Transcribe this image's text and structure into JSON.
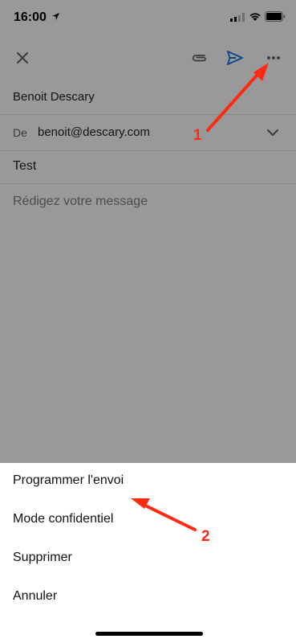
{
  "status_bar": {
    "time": "16:00"
  },
  "compose": {
    "to": "Benoit Descary",
    "from_label": "De",
    "from": "benoit@descary.com",
    "subject": "Test",
    "body_placeholder": "Rédigez votre message"
  },
  "action_sheet": {
    "items": [
      "Programmer l'envoi",
      "Mode confidentiel",
      "Supprimer",
      "Annuler"
    ]
  },
  "annotations": {
    "step1": "1",
    "step2": "2"
  },
  "colors": {
    "send_icon": "#1a73e8",
    "annotation": "#ff2a12",
    "overlay": "rgba(0,0,0,0.4)"
  }
}
